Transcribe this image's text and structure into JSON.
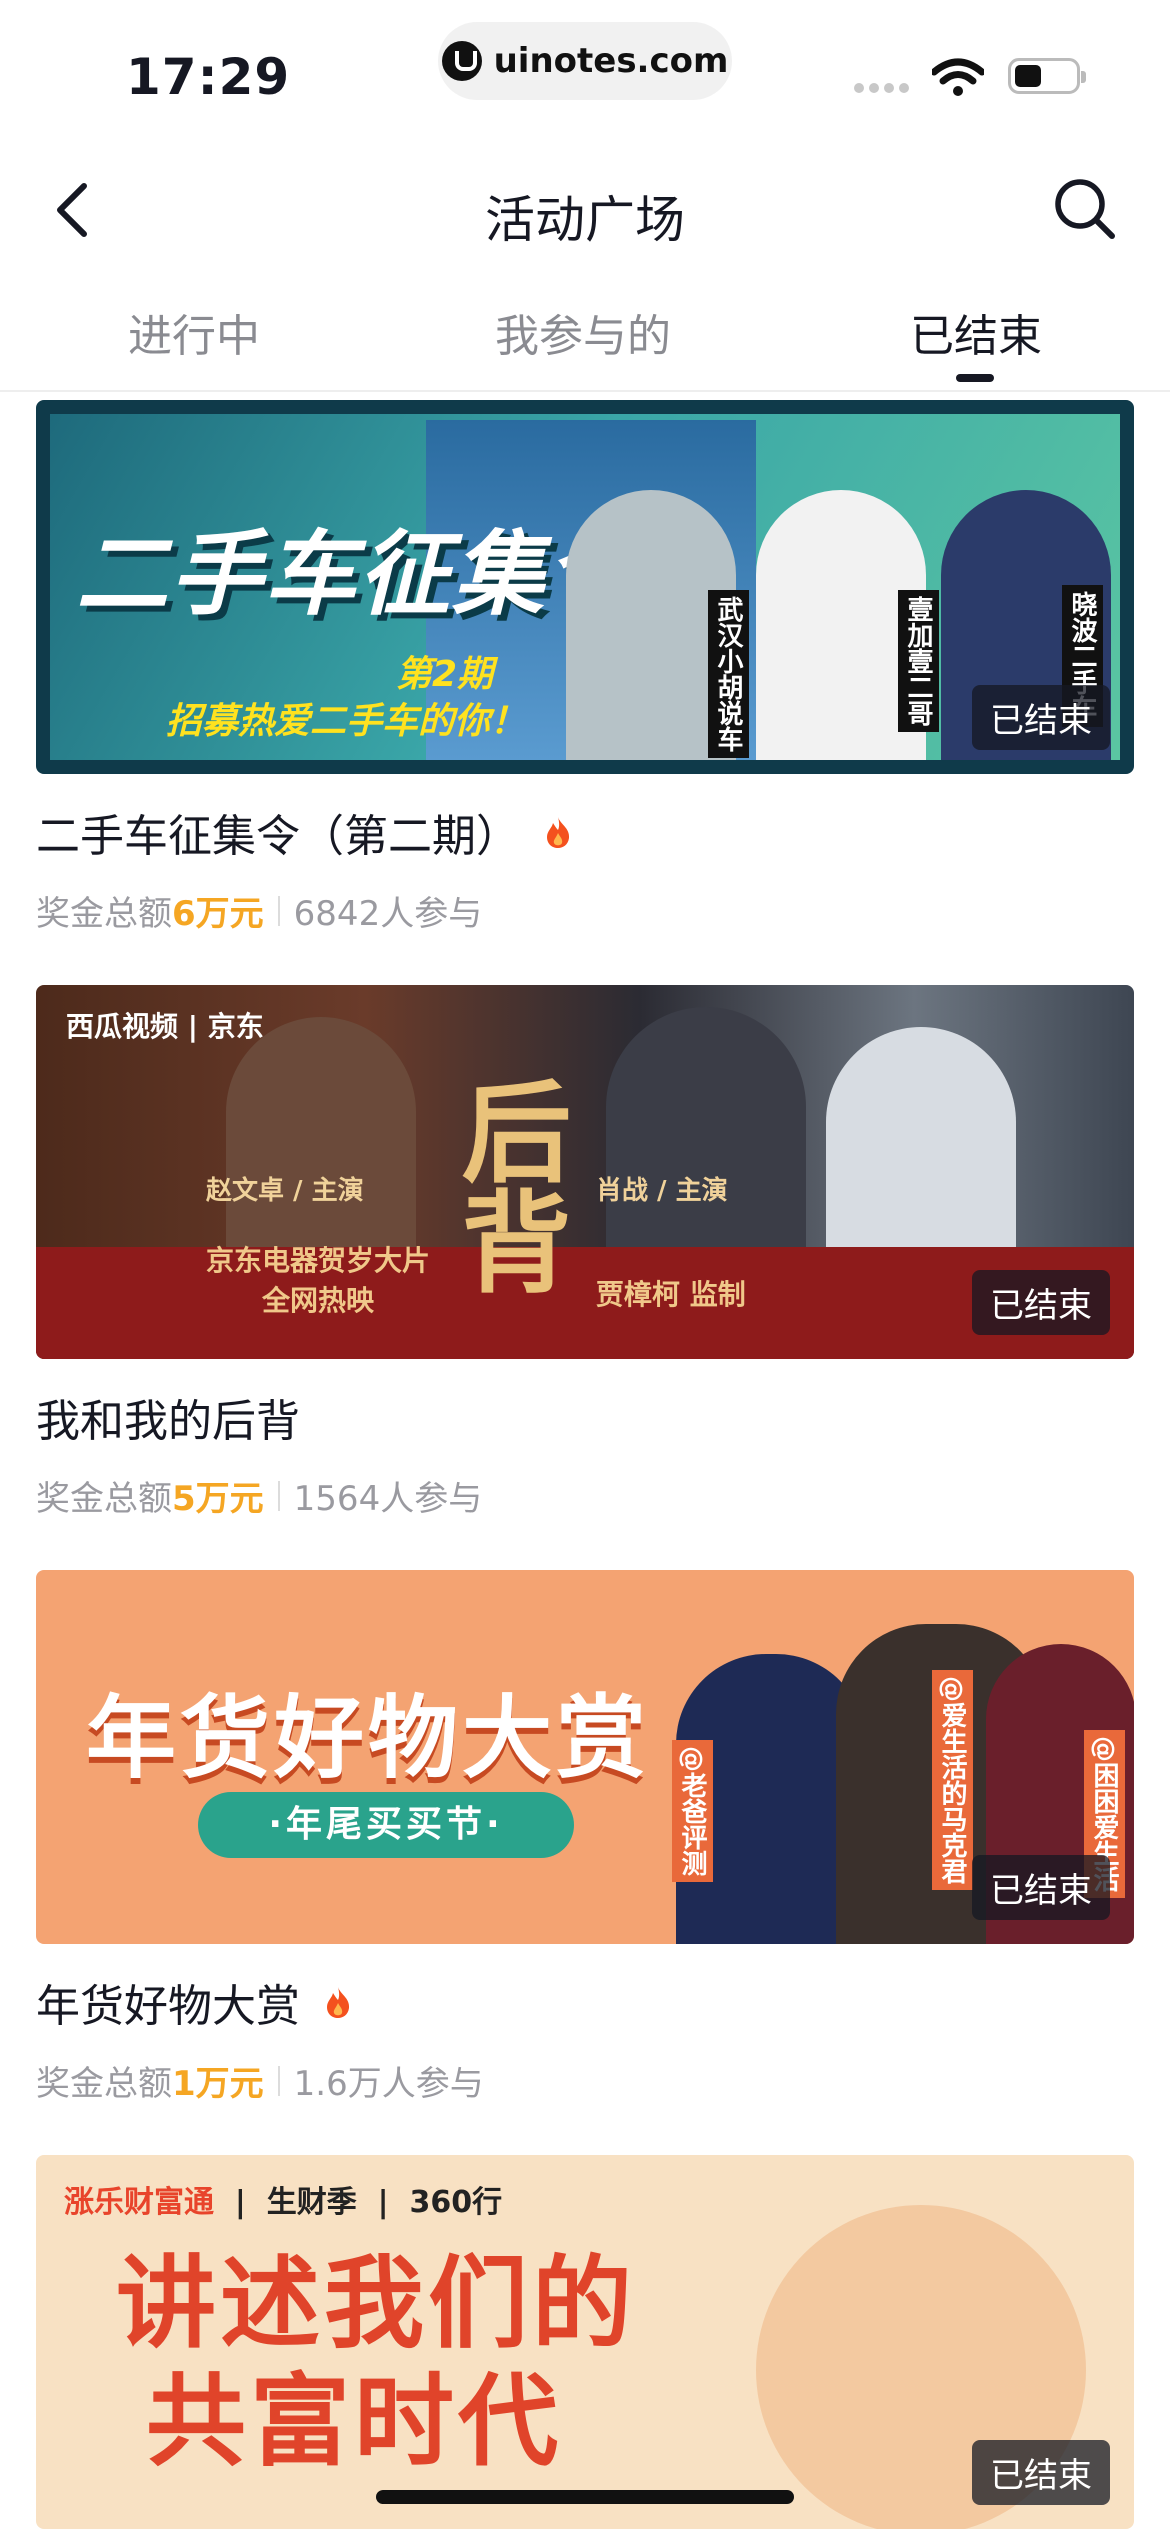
{
  "status_bar": {
    "time": "17:29",
    "url": "uinotes.com"
  },
  "nav": {
    "title": "活动广场"
  },
  "tabs": [
    {
      "label": "进行中",
      "active": false
    },
    {
      "label": "我参与的",
      "active": false
    },
    {
      "label": "已结束",
      "active": true
    }
  ],
  "cards": [
    {
      "title": "二手车征集令（第二期）",
      "hot": true,
      "badge": "已结束",
      "prize_label": "奖金总额",
      "prize_amount": "6万元",
      "participants": "6842人参与",
      "banner": {
        "headline": "二手车征集令",
        "issue": "第2期",
        "slogan": "招募热爱二手车的你！",
        "tags": [
          "武汉小胡说车",
          "壹加壹二哥",
          "晓波二手车"
        ]
      }
    },
    {
      "title": "我和我的后背",
      "hot": false,
      "badge": "已结束",
      "prize_label": "奖金总额",
      "prize_amount": "5万元",
      "participants": "1564人参与",
      "banner": {
        "logos": "西瓜视频 | 京东",
        "headline": "后背",
        "name1": "赵文卓 / 主演",
        "name2": "肖战 / 主演",
        "line1": "京东电器贺岁大片",
        "line2": "全网热映",
        "director": "贾樟柯 监制"
      }
    },
    {
      "title": "年货好物大赏",
      "hot": true,
      "badge": "已结束",
      "prize_label": "奖金总额",
      "prize_amount": "1万元",
      "participants": "1.6万人参与",
      "banner": {
        "headline": "年货好物大赏",
        "pill": "·年尾买买节·",
        "tags": [
          "@老爸评测",
          "@爱生活的马克君",
          "@困困爱生活"
        ]
      }
    },
    {
      "title": "",
      "badge": "已结束",
      "banner": {
        "brand_left": "涨乐财富通",
        "brand_mid": "生财季",
        "brand_right": "360行",
        "headline1": "讲述我们的",
        "headline2": "共富时代"
      }
    }
  ],
  "colors": {
    "accent_amount": "#f5a623",
    "text_primary": "#161823",
    "text_secondary": "#9a9aa0"
  }
}
